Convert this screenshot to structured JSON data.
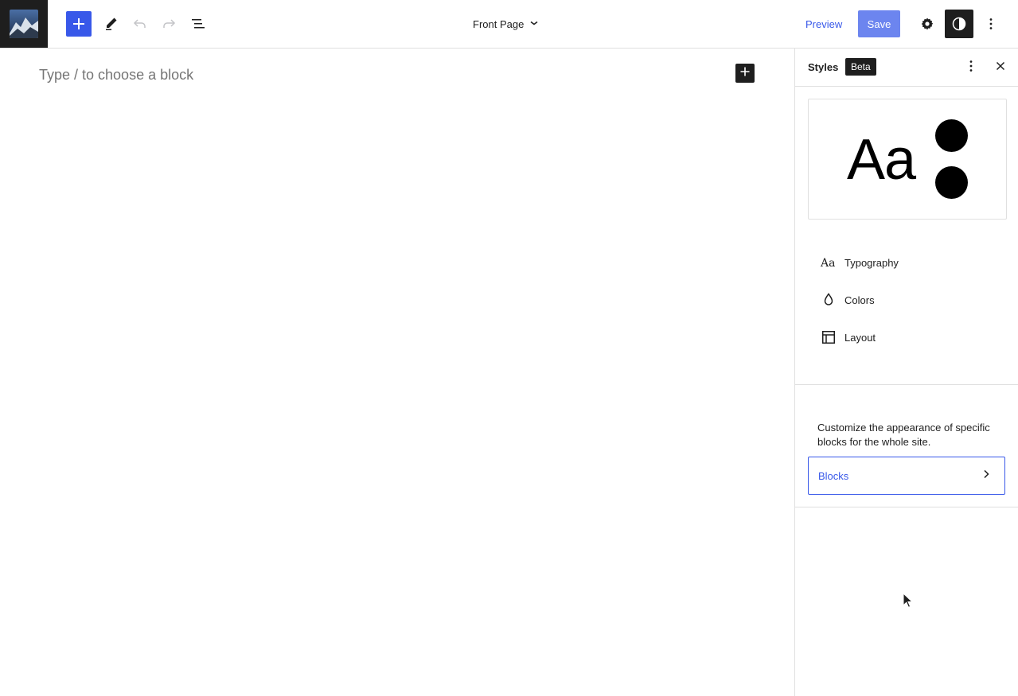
{
  "header": {
    "document_title": "Front Page",
    "preview_label": "Preview",
    "save_label": "Save",
    "icons": {
      "site": "site-icon-thumbnail",
      "inserter": "plus-icon",
      "tools": "pencil-icon",
      "undo": "undo-icon",
      "redo": "redo-icon",
      "list_view": "list-view-icon",
      "title_dropdown": "chevron-down-icon",
      "settings": "gear-icon",
      "styles": "half-circle-contrast-icon",
      "options": "vertical-ellipsis-icon"
    }
  },
  "canvas": {
    "placeholder": "Type / to choose a block",
    "inserter_icon": "plus-icon"
  },
  "sidebar": {
    "title": "Styles",
    "badge": "Beta",
    "preview": {
      "sample_text": "Aa"
    },
    "items": [
      {
        "label": "Typography",
        "icon": "typography-icon"
      },
      {
        "label": "Colors",
        "icon": "droplet-icon"
      },
      {
        "label": "Layout",
        "icon": "layout-icon"
      }
    ],
    "blocks_description": "Customize the appearance of specific blocks for the whole site.",
    "blocks_button": "Blocks"
  },
  "colors": {
    "accent": "#3858e9",
    "save_disabled": "#6c85ef",
    "dark": "#1e1e1e",
    "placeholder_text": "#757575",
    "border": "#e0e0e0"
  }
}
